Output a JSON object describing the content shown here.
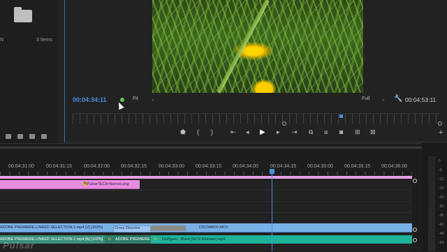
{
  "project": {
    "folder_icon": "folder-icon",
    "partial_name": "N",
    "item_count": "3 Items",
    "tools": [
      "search-icon",
      "new-bin-icon",
      "new-item-icon",
      "trash-icon"
    ]
  },
  "monitor": {
    "timecode_current": "00:04:34:11",
    "fit_label": "Fit",
    "quality_label": "Full",
    "timecode_duration": "00:04:53:11",
    "transport_icons": [
      "add-marker",
      "mark-in",
      "mark-out",
      "go-to-in",
      "step-back",
      "play",
      "step-forward",
      "go-to-out",
      "insert",
      "overwrite",
      "export-frame",
      "compare",
      "add"
    ]
  },
  "timeline": {
    "ruler_labels": [
      "00:04:31:00",
      "00:04:31:15",
      "00:04:32:00",
      "00:04:32:15",
      "00:04:33:00",
      "00:04:33:15",
      "00:04:34:00",
      "00:04:34:15",
      "00:04:35:00",
      "00:04:35:15",
      "00:04:36:00"
    ],
    "clips": {
      "graphic_clip": {
        "fx": "fx",
        "label": "PulsarTECH-Narrow.png"
      },
      "video_clip_1": {
        "label": "ADOBE PREMIERE LINKED SELECTION 2.mp4 [V] [102%]"
      },
      "transition": {
        "label": "Cross Dissolve"
      },
      "video_clip_2": {
        "label": "DSCN8829.MOV"
      },
      "audio_clip_1": {
        "label": "ADOBE PREMIERE LINKED SELECTION 2.mp4 [A] [102%]"
      },
      "audio_clip_2": {
        "fx": "fx",
        "label": "ADOBE PREMIERE"
      },
      "audio_clip_3": {
        "fx": "fx",
        "label": "Disfigure - Blank [NCS Release].mp3"
      }
    }
  },
  "meters": {
    "labels": [
      "0",
      "-6",
      "-12",
      "-18",
      "-24",
      "-30",
      "-36",
      "-42",
      "-48",
      "-54"
    ]
  },
  "watermark": "Pulsar"
}
